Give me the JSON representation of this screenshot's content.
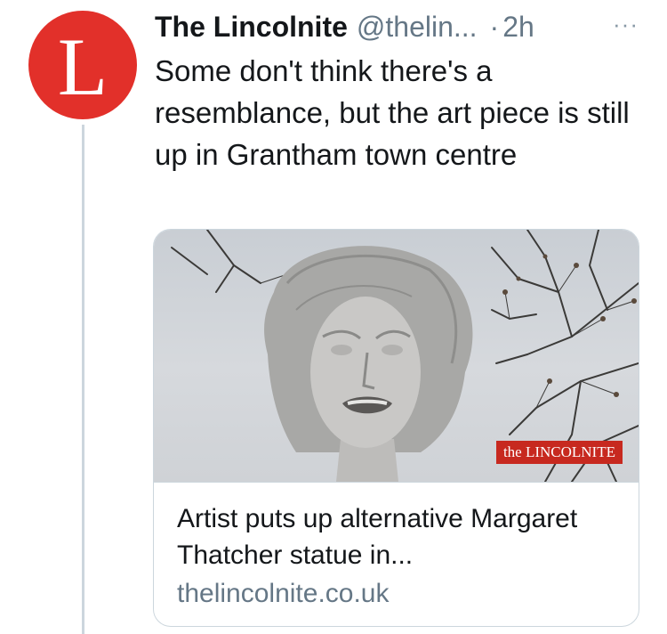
{
  "tweet": {
    "avatar_letter": "L",
    "display_name": "The Lincolnite",
    "handle": "@thelin...",
    "separator": "·",
    "time": "2h",
    "more_icon": "···",
    "text": "Some don't think there's a resemblance, but the art piece is still up in Grantham town centre"
  },
  "card": {
    "watermark": "the LINCOLNITE",
    "title": "Artist puts up alternative Margaret Thatcher statue in...",
    "domain": "thelincolnite.co.uk"
  },
  "colors": {
    "avatar_bg": "#e2302a",
    "watermark_bg": "#c7291f",
    "thread_line": "#ccd6dd"
  }
}
